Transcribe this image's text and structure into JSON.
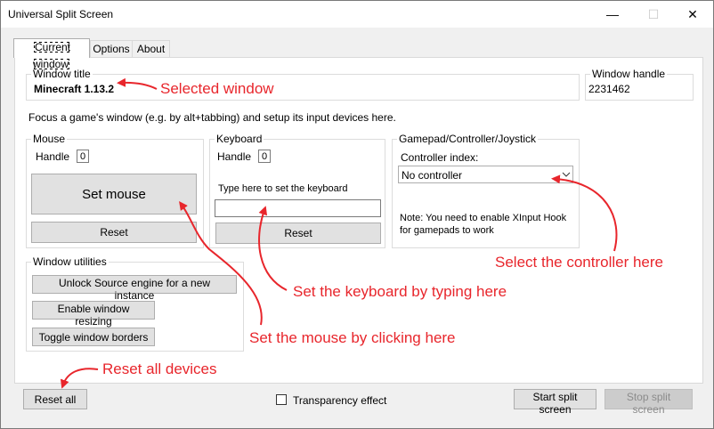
{
  "window": {
    "title": "Universal Split Screen",
    "minimize": "—",
    "maximize": "☐",
    "close": "✕"
  },
  "tabs": [
    {
      "label": "Current window"
    },
    {
      "label": "Options"
    },
    {
      "label": "About"
    }
  ],
  "window_title_group": {
    "label": "Window title",
    "value": "Minecraft  1.13.2"
  },
  "window_handle_group": {
    "label": "Window handle",
    "value": "2231462"
  },
  "instructions": "Focus a game's window (e.g. by alt+tabbing) and setup its input devices here.",
  "mouse": {
    "label": "Mouse",
    "handle_label": "Handle",
    "handle_value": "0",
    "set_button": "Set mouse",
    "reset_button": "Reset"
  },
  "keyboard": {
    "label": "Keyboard",
    "handle_label": "Handle",
    "handle_value": "0",
    "hint": "Type here to set the keyboard",
    "input_value": "",
    "reset_button": "Reset"
  },
  "gamepad": {
    "label": "Gamepad/Controller/Joystick",
    "index_label": "Controller index:",
    "selected": "No controller",
    "note": "Note: You need to enable XInput Hook for gamepads to work"
  },
  "utilities": {
    "label": "Window utilities",
    "unlock_button": "Unlock Source engine for a new instance",
    "resize_button": "Enable window resizing",
    "borders_button": "Toggle window borders"
  },
  "footer": {
    "reset_all": "Reset all",
    "transparency_label": "Transparency effect",
    "transparency_checked": false,
    "start_button": "Start split screen",
    "stop_button": "Stop split screen"
  },
  "annotations": {
    "selected_window": "Selected window",
    "select_controller": "Select the controller here",
    "set_keyboard": "Set the keyboard by typing here",
    "set_mouse": "Set the mouse by clicking here",
    "reset_all": "Reset all devices",
    "color": "#e8262c"
  },
  "colors": {
    "title_bg": "#ffffff",
    "window_bg": "#f0f0f0",
    "panel_bg": "#ffffff",
    "button_bg": "#e1e1e1"
  }
}
